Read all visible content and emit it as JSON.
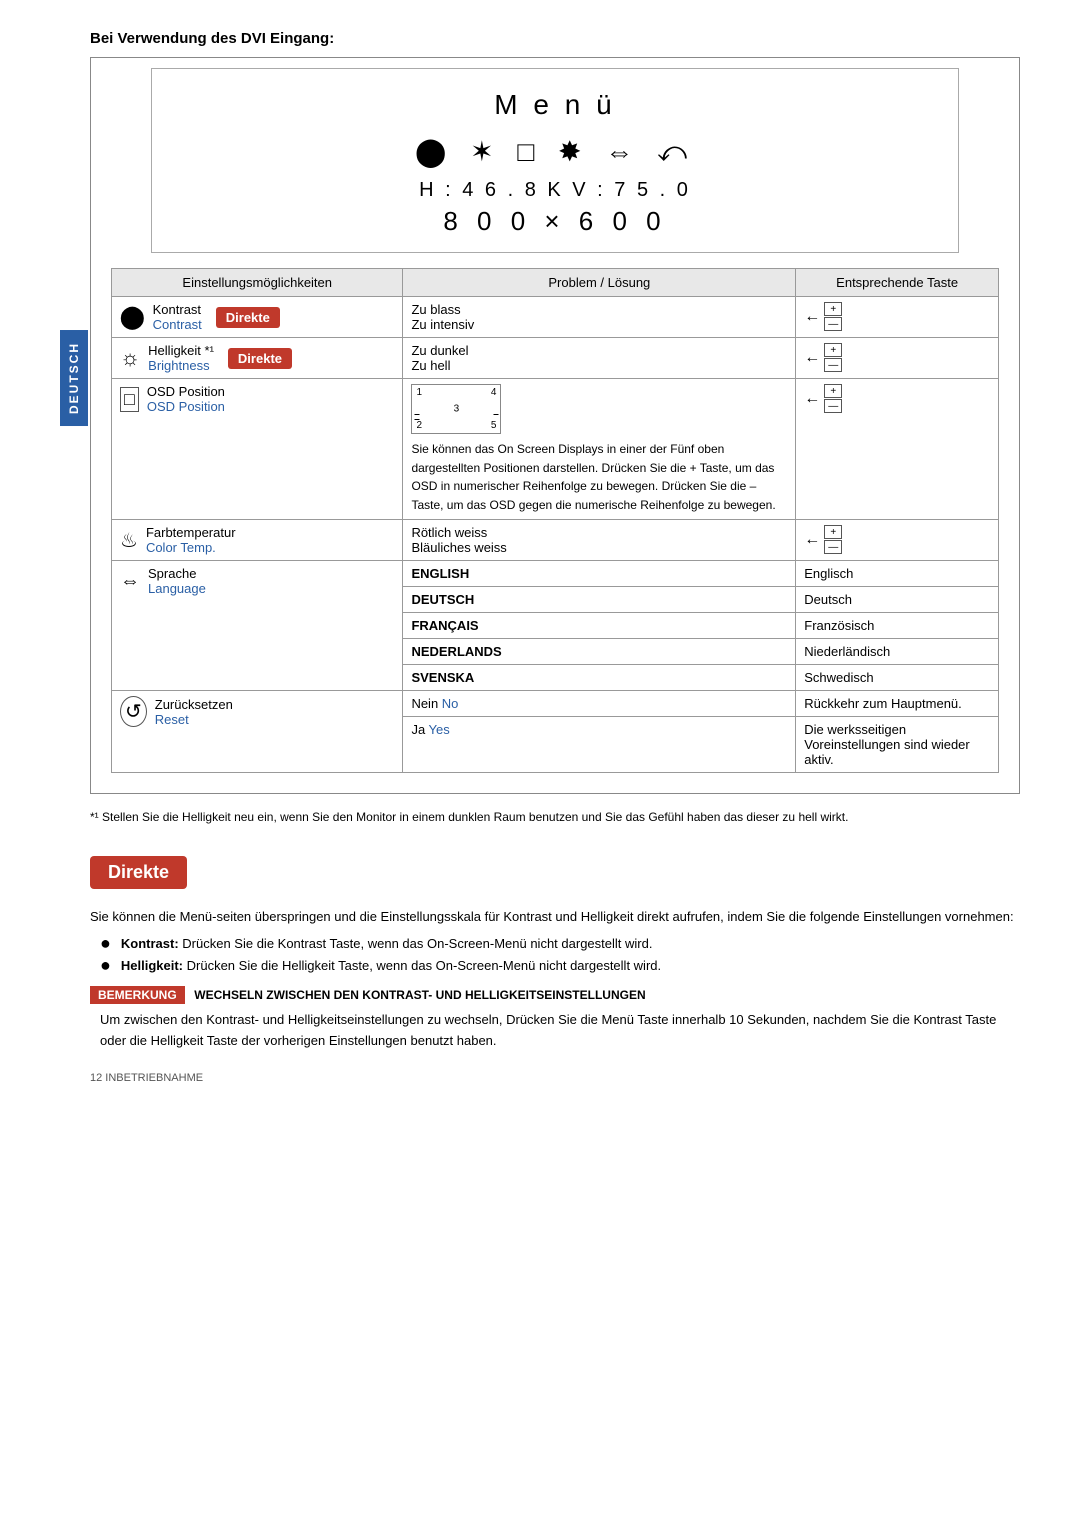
{
  "page": {
    "heading": "Bei Verwendung des DVI Eingang:",
    "sidebar_label": "DEUTSCH",
    "menu": {
      "title": "M e n ü",
      "icons": "● ✿ □ ❀ ⇔ ↺",
      "freq": "H : 4 6 . 8 K   V : 7 5 . 0",
      "res": "8 0 0  ×  6 0 0"
    },
    "table": {
      "headers": [
        "Einstellungsmöglichkeiten",
        "Problem / Lösung",
        "Entsprechende Taste"
      ],
      "rows": [
        {
          "icon": "●",
          "setting_de": "Kontrast",
          "setting_en": "Contrast",
          "direkte": true,
          "problem1": "Zu blass",
          "problem2": "Zu intensiv",
          "has_arrows": true
        },
        {
          "icon": "✿",
          "setting_de": "Helligkeit *¹",
          "setting_en": "Brightness",
          "direkte": true,
          "problem1": "Zu dunkel",
          "problem2": "Zu hell",
          "has_arrows": true
        },
        {
          "icon": "□",
          "setting_de": "OSD Position",
          "setting_en": "OSD Position",
          "direkte": false,
          "osd": true,
          "problem_text": "Sie können das On Screen Displays in einer der Fünf oben dargestellten Positionen darstellen. Drücken Sie die + Taste, um das OSD in numerischer Reihenfolge zu bewegen. Drücken Sie die – Taste, um das OSD gegen die numerische Reihenfolge zu bewegen.",
          "has_arrows": true
        },
        {
          "icon": "❀",
          "setting_de": "Farbtemperatur",
          "setting_en": "Color Temp.",
          "direkte": false,
          "problem1": "Rötlich weiss",
          "problem2": "Bläuliches weiss",
          "has_arrows": true
        },
        {
          "icon": "⇔",
          "setting_de": "Sprache",
          "setting_en": "Language",
          "direkte": false,
          "languages": [
            {
              "code": "ENGLISH",
              "name": "Englisch"
            },
            {
              "code": "DEUTSCH",
              "name": "Deutsch"
            },
            {
              "code": "FRANÇAIS",
              "name": "Französisch"
            },
            {
              "code": "NEDERLANDS",
              "name": "Niederländisch"
            },
            {
              "code": "SVENSKA",
              "name": "Schwedisch"
            }
          ]
        },
        {
          "icon": "↺",
          "setting_de": "Zurücksetzen",
          "setting_en": "Reset",
          "direkte": false,
          "reset_rows": [
            {
              "code_de": "Nein",
              "code_en": "No",
              "desc": "Rückkehr zum Hauptmenü."
            },
            {
              "code_de": "Ja",
              "code_en": "Yes",
              "desc": "Die werksseitigen Voreinstellungen sind wieder aktiv."
            }
          ]
        }
      ]
    },
    "footnote": "*¹  Stellen Sie die Helligkeit neu ein, wenn Sie den Monitor in einem dunklen Raum benutzen und Sie das Gefühl haben das dieser zu hell wirkt.",
    "direkte_section": {
      "label": "Direkte",
      "intro": "Sie können die Menü-seiten überspringen und die Einstellungsskala für Kontrast und Helligkeit direkt aufrufen, indem Sie die folgende Einstellungen vornehmen:",
      "items": [
        {
          "label": "Kontrast:",
          "text": "Drücken Sie die Kontrast Taste, wenn das On-Screen-Menü nicht dargestellt wird."
        },
        {
          "label": "Helligkeit:",
          "text": "Drücken Sie die Helligkeit Taste, wenn das On-Screen-Menü nicht dargestellt wird."
        }
      ],
      "bemerkung_label": "BEMERKUNG",
      "bemerkung_title": "WECHSELN ZWISCHEN DEN KONTRAST- UND HELLIGKEITSEINSTELLUNGEN",
      "bemerkung_body": "Um zwischen den Kontrast- und Helligkeitseinstellungen zu wechseln, Drücken Sie die Menü Taste innerhalb 10 Sekunden, nachdem Sie die Kontrast Taste oder die Helligkeit Taste der vorherigen Einstellungen benutzt haben."
    },
    "footer": "12   INBETRIEBNAHME"
  }
}
